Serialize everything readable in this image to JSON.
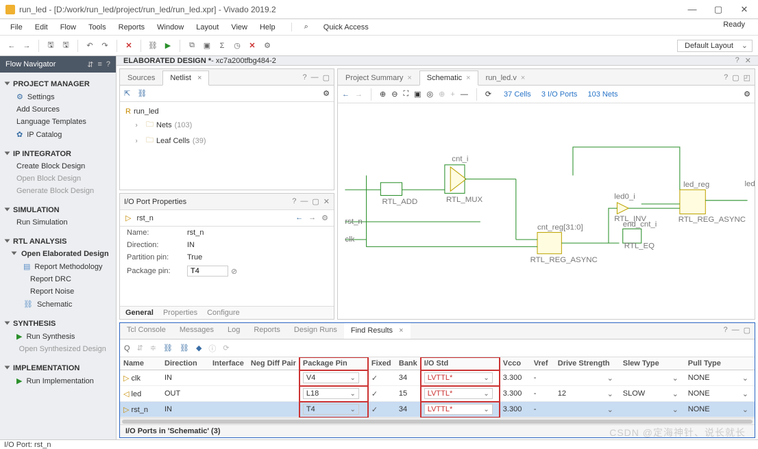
{
  "window": {
    "title": "run_led - [D:/work/run_led/project/run_led/run_led.xpr] - Vivado 2019.2",
    "app": "Vivado 2019.2"
  },
  "menu": {
    "file": "File",
    "edit": "Edit",
    "flow": "Flow",
    "tools": "Tools",
    "reports": "Reports",
    "window": "Window",
    "layout": "Layout",
    "view": "View",
    "help": "Help",
    "quick": "Quick Access",
    "ready": "Ready"
  },
  "layout_dd": "Default Layout",
  "flow_nav": {
    "title": "Flow Navigator",
    "pm": "PROJECT MANAGER",
    "settings": "Settings",
    "add_src": "Add Sources",
    "lang_tpl": "Language Templates",
    "ip_cat": "IP Catalog",
    "ipi": "IP INTEGRATOR",
    "cbd": "Create Block Design",
    "obd": "Open Block Design",
    "gbd": "Generate Block Design",
    "sim": "SIMULATION",
    "runsim": "Run Simulation",
    "rtl": "RTL ANALYSIS",
    "oed": "Open Elaborated Design",
    "rm": "Report Methodology",
    "rdrc": "Report DRC",
    "rn": "Report Noise",
    "schem": "Schematic",
    "syn": "SYNTHESIS",
    "runsyn": "Run Synthesis",
    "osd": "Open Synthesized Design",
    "impl": "IMPLEMENTATION",
    "runimpl": "Run Implementation"
  },
  "elab_header": {
    "title": "ELABORATED DESIGN *",
    "sub": " - xc7a200tfbg484-2"
  },
  "netlist": {
    "tabs": {
      "sources": "Sources",
      "netlist": "Netlist"
    },
    "root": "run_led",
    "nets": "Nets",
    "nets_cnt": "(103)",
    "leaf": "Leaf Cells",
    "leaf_cnt": "(39)"
  },
  "io_prop": {
    "title": "I/O Port Properties",
    "port": "rst_n",
    "name_lbl": "Name:",
    "name_val": "rst_n",
    "dir_lbl": "Direction:",
    "dir_val": "IN",
    "pp_lbl": "Partition pin:",
    "pp_val": "True",
    "pkg_lbl": "Package pin:",
    "pkg_val": "T4",
    "gen": "General",
    "props": "Properties",
    "cfg": "Configure"
  },
  "schem_tabs": {
    "ps": "Project Summary",
    "sc": "Schematic",
    "rl": "run_led.v"
  },
  "schem_info": {
    "cells": "37 Cells",
    "io": "3 I/O Ports",
    "nets": "103 Nets"
  },
  "schem_labels": {
    "rst_n": "rst_n",
    "clk": "clk",
    "led": "led",
    "rtladd": "RTL_ADD",
    "rtlmux": "RTL_MUX",
    "rtlrega": "RTL_REG_ASYNC",
    "rtlinv": "RTL_INV",
    "rtleq": "RTL_EQ",
    "ledreg": "led_reg",
    "cnti": "cnt_i",
    "cntreg": "cnt_reg[31:0]",
    "endcnti": "end_cnt_i",
    "led0i": "led0_i"
  },
  "bottom": {
    "tabs": {
      "tcl": "Tcl Console",
      "msg": "Messages",
      "log": "Log",
      "rpt": "Reports",
      "dr": "Design Runs",
      "fr": "Find Results"
    },
    "headers": {
      "name": "Name",
      "dir": "Direction",
      "iface": "Interface",
      "ndp": "Neg Diff Pair",
      "pkg": "Package Pin",
      "fixed": "Fixed",
      "bank": "Bank",
      "iostd": "I/O Std",
      "vcco": "Vcco",
      "vref": "Vref",
      "ds": "Drive Strength",
      "slew": "Slew Type",
      "pull": "Pull Type"
    },
    "rows": [
      {
        "name": "clk",
        "dir": "IN",
        "pkg": "V4",
        "bank": "34",
        "iostd": "LVTTL*",
        "vcco": "3.300",
        "vref": "-",
        "ds": "",
        "slew": "",
        "pull": "NONE"
      },
      {
        "name": "led",
        "dir": "OUT",
        "pkg": "L18",
        "bank": "15",
        "iostd": "LVTTL*",
        "vcco": "3.300",
        "vref": "-",
        "ds": "12",
        "slew": "SLOW",
        "pull": "NONE"
      },
      {
        "name": "rst_n",
        "dir": "IN",
        "pkg": "T4",
        "bank": "34",
        "iostd": "LVTTL*",
        "vcco": "3.300",
        "vref": "-",
        "ds": "",
        "slew": "",
        "pull": "NONE"
      }
    ],
    "footer": "I/O Ports in 'Schematic' (3)"
  },
  "status_bar": "I/O Port: rst_n",
  "watermark": "CSDN @定海神针、说长就长"
}
